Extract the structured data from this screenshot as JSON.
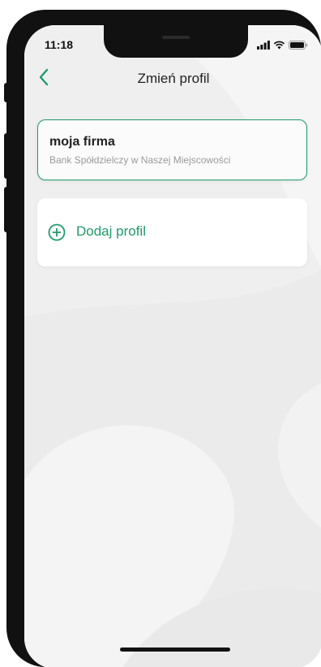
{
  "status_bar": {
    "time": "11:18",
    "icons": [
      "signal-icon",
      "wifi-icon",
      "battery-icon"
    ]
  },
  "nav": {
    "back_icon": "chevron-left-icon",
    "title": "Zmień profil"
  },
  "profiles": [
    {
      "name": "moja firma",
      "bank": "Bank Spółdzielczy w Naszej Miejscowości",
      "selected": true
    }
  ],
  "add_profile": {
    "icon": "plus-circle-icon",
    "label": "Dodaj profil"
  },
  "colors": {
    "accent": "#1f9b6a",
    "background": "#efefef",
    "card": "#ffffff",
    "device_frame": "#111111"
  }
}
